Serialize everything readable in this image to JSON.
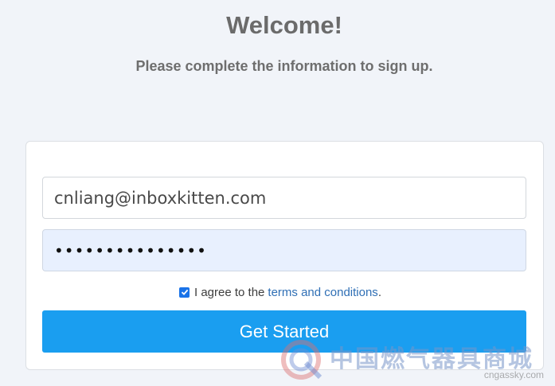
{
  "header": {
    "title": "Welcome!",
    "subtitle": "Please complete the information to sign up."
  },
  "form": {
    "email_value": "cnliang@inboxkitten.com",
    "password_mask": "•••••••••••••••",
    "agree_text": "I agree to the",
    "terms_link": "terms and conditions",
    "agree_suffix": ".",
    "agree_checked": true,
    "submit_label": "Get Started"
  },
  "watermark": {
    "text": "中国燃气器具商城",
    "url": "cngassky.com"
  },
  "colors": {
    "background": "#f1f4f9",
    "button": "#1a9ef0",
    "link": "#2f6fb5",
    "autofill": "#e8f0fe"
  }
}
